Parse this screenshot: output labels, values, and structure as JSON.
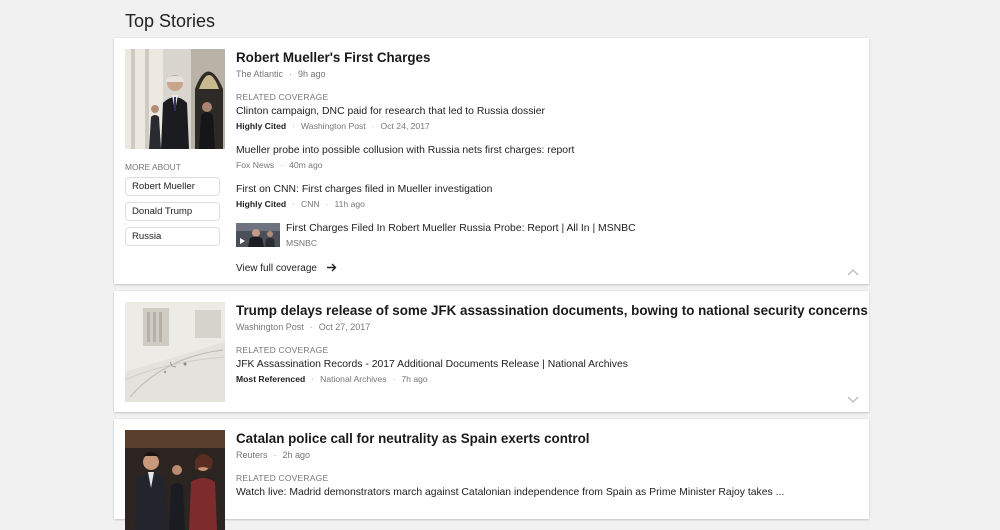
{
  "page": {
    "title": "Top Stories"
  },
  "story1": {
    "headline": "Robert Mueller's First Charges",
    "source": "The Atlantic",
    "time": "9h ago",
    "related_label": "RELATED COVERAGE",
    "related": [
      {
        "title": "Clinton campaign, DNC paid for research that led to Russia dossier",
        "tag": "Highly Cited",
        "source": "Washington Post",
        "time": "Oct 24, 2017"
      },
      {
        "title": "Mueller probe into possible collusion with Russia nets first charges: report",
        "tag": "",
        "source": "Fox News",
        "time": "40m ago"
      },
      {
        "title": "First on CNN: First charges filed in Mueller investigation",
        "tag": "Highly Cited",
        "source": "CNN",
        "time": "11h ago"
      },
      {
        "title": "First Charges Filed In Robert Mueller Russia Probe: Report | All In | MSNBC",
        "source": "MSNBC"
      }
    ],
    "more_about_label": "MORE ABOUT",
    "topics": [
      "Robert Mueller",
      "Donald Trump",
      "Russia"
    ],
    "view_full": "View full coverage",
    "chevron_icon": "chevron-up-icon"
  },
  "story2": {
    "headline": "Trump delays release of some JFK assassination documents, bowing to national security concerns",
    "source": "Washington Post",
    "time": "Oct 27, 2017",
    "related_label": "RELATED COVERAGE",
    "related": [
      {
        "title": "JFK Assassination Records - 2017 Additional Documents Release | National Archives",
        "tag": "Most Referenced",
        "source": "National Archives",
        "time": "7h ago"
      }
    ],
    "chevron_icon": "chevron-down-icon"
  },
  "story3": {
    "headline": "Catalan police call for neutrality as Spain exerts control",
    "source": "Reuters",
    "time": "2h ago",
    "related_label": "RELATED COVERAGE",
    "related": [
      {
        "title": "Watch live: Madrid demonstrators march against Catalonian independence from Spain as Prime Minister Rajoy takes ..."
      }
    ]
  }
}
